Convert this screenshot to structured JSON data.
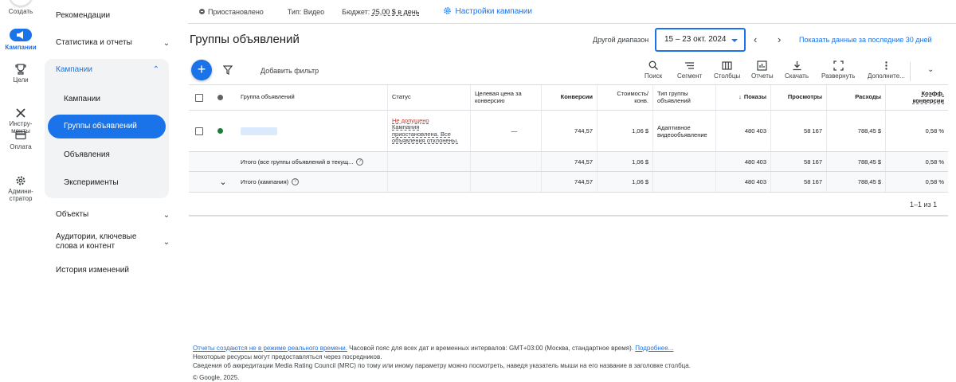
{
  "rail": {
    "create": "Создать",
    "campaigns": "Кампании",
    "goals": "Цели",
    "tools": "Инстру-\nменты",
    "billing": "Оплата",
    "admin": "Админи-\nстратор"
  },
  "nav": {
    "recommendations": "Рекомендации",
    "stats": "Статистика и отчеты",
    "campaigns": "Кампании",
    "sub": {
      "campaigns": "Кампании",
      "ad_groups": "Группы объявлений",
      "ads": "Объявления",
      "experiments": "Эксперименты"
    },
    "objects": "Объекты",
    "audiences": "Аудитории, ключевые слова и контент",
    "history": "История изменений"
  },
  "topbar": {
    "status": "Приостановлено",
    "type_label": "Тип:",
    "type_value": "Видео",
    "budget_label": "Бюджет:",
    "budget_value": "25,00 $ в день",
    "settings": "Настройки кампании"
  },
  "header": {
    "title": "Группы объявлений",
    "range_label": "Другой диапазон",
    "range_value": "15 – 23 окт. 2024",
    "last30": "Показать данные за последние 30 дней"
  },
  "toolbar": {
    "add_filter": "Добавить фильтр",
    "search": "Поиск",
    "segment": "Сегмент",
    "columns": "Столбцы",
    "reports": "Отчеты",
    "download": "Скачать",
    "expand": "Развернуть",
    "more": "Дополните..."
  },
  "table": {
    "headers": {
      "group": "Группа объявлений",
      "status": "Статус",
      "target": "Целевая цена за конверсию",
      "conv": "Конверсии",
      "cost_conv": "Стоимость/ конв.",
      "type": "Тип группы объявлений",
      "impr": "Показы",
      "views": "Просмотры",
      "cost": "Расходы",
      "conv_rate": "Коэфф. конверсии"
    },
    "row": {
      "status_main": "Не допущено",
      "status_sub": "Кампания приостановлена. Все объявления отклонены.",
      "target": "—",
      "conv": "744,57",
      "cost_conv": "1,06 $",
      "type": "Адаптивное видеообъявление",
      "impr": "480 403",
      "views": "58 167",
      "cost": "788,45 $",
      "conv_rate": "0,58 %"
    },
    "total_groups": {
      "label": "Итого (все группы объявлений в текущ...",
      "conv": "744,57",
      "cost_conv": "1,06 $",
      "impr": "480 403",
      "views": "58 167",
      "cost": "788,45 $",
      "conv_rate": "0,58 %"
    },
    "total_campaign": {
      "label": "Итого (кампания)",
      "conv": "744,57",
      "cost_conv": "1,06 $",
      "impr": "480 403",
      "views": "58 167",
      "cost": "788,45 $",
      "conv_rate": "0,58 %"
    },
    "pager": "1–1 из 1"
  },
  "footer": {
    "line1_link": "Отчеты создаются не в режиме реального времени.",
    "line1_text": " Часовой пояс для всех дат и временных интервалов: GMT+03:00 (Москва, стандартное время). ",
    "line1_more": "Подробнее...",
    "line2": "Некоторые ресурсы могут предоставляться через посредников.",
    "line3": "Сведения об аккредитации Media Rating Council (MRC) по тому или иному параметру можно посмотреть, наведя указатель мыши на его название в заголовке столбца.",
    "line4": "© Google, 2025."
  },
  "colors": {
    "accent": "#1a73e8",
    "error": "#d93025",
    "enabled": "#188038"
  }
}
